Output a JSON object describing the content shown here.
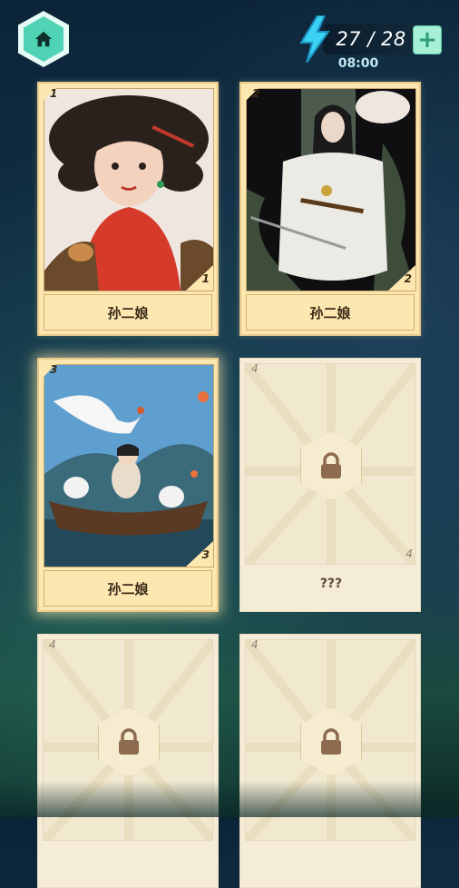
{
  "header": {
    "home_icon": "home-icon",
    "energy_icon": "lightning-bolt-icon",
    "energy_count": "27 / 28",
    "add_label": "+",
    "timer": "08:00"
  },
  "cards": [
    {
      "number": "1",
      "name": "孙二娘",
      "locked": false
    },
    {
      "number": "2",
      "name": "孙二娘",
      "locked": false
    },
    {
      "number": "3",
      "name": "孙二娘",
      "locked": false
    },
    {
      "number": "4",
      "name": "???",
      "locked": true
    },
    {
      "number": "4",
      "name": "",
      "locked": true
    },
    {
      "number": "4",
      "name": "",
      "locked": true
    }
  ],
  "colors": {
    "card_unlocked": "#fde7b0",
    "card_locked": "#f4ecd7",
    "accent": "#4fd3b4"
  }
}
